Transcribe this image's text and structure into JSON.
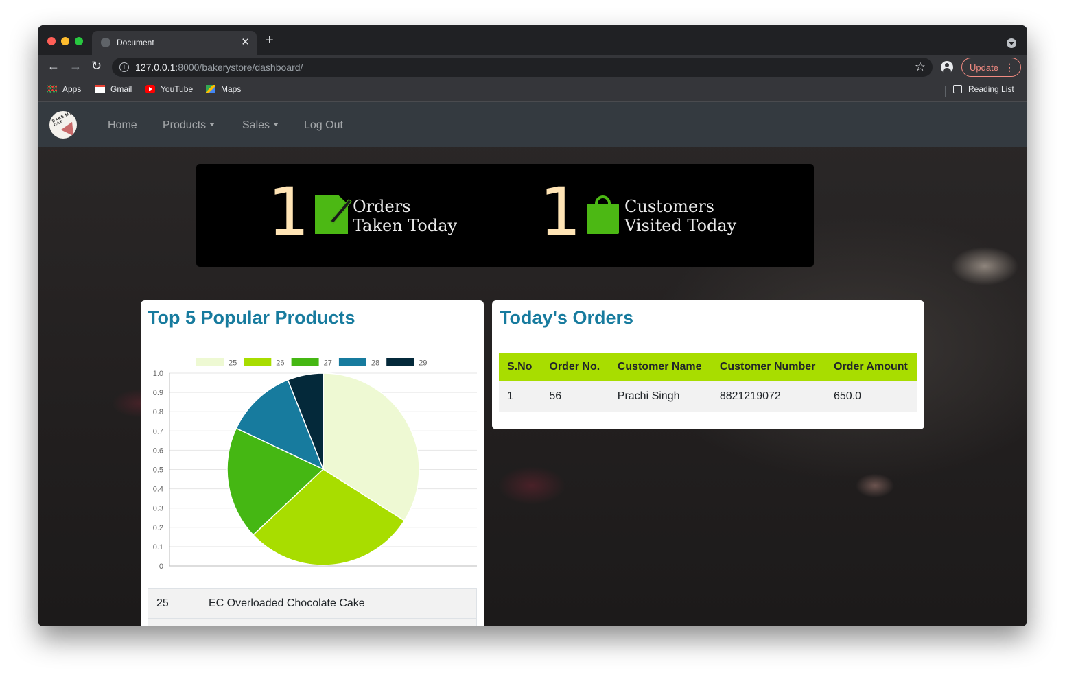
{
  "browser": {
    "tab_title": "Document",
    "url_host": "127.0.0.1",
    "url_rest": ":8000/bakerystore/dashboard/",
    "update_label": "Update",
    "bookmarks": {
      "apps": "Apps",
      "gmail": "Gmail",
      "youtube": "YouTube",
      "maps": "Maps",
      "reading_list": "Reading List"
    }
  },
  "nav": {
    "logo_text": "BAKE MY DAY",
    "home": "Home",
    "products": "Products",
    "sales": "Sales",
    "logout": "Log Out"
  },
  "stats": {
    "orders_count": "1",
    "orders_label": "Orders\nTaken Today",
    "customers_count": "1",
    "customers_label": "Customers\nVisited Today"
  },
  "popular": {
    "title": "Top 5 Popular Products",
    "rows": [
      {
        "id": "25",
        "name": "EC Overloaded Chocolate Cake"
      },
      {
        "id": "",
        "name": ""
      }
    ]
  },
  "chart_data": {
    "type": "pie",
    "categories": [
      "25",
      "26",
      "27",
      "28",
      "29"
    ],
    "values": [
      34,
      29,
      19,
      12,
      6
    ],
    "colors": [
      "#eef9d3",
      "#a8dd00",
      "#45b713",
      "#177b9e",
      "#04293a"
    ],
    "legend_position": "top",
    "y_ticks": [
      "0",
      "0.1",
      "0.2",
      "0.3",
      "0.4",
      "0.5",
      "0.6",
      "0.7",
      "0.8",
      "0.9",
      "1.0"
    ],
    "ylim": [
      0,
      1
    ],
    "grid": true
  },
  "orders": {
    "title": "Today's Orders",
    "headers": [
      "S.No",
      "Order No.",
      "Customer Name",
      "Customer Number",
      "Order Amount"
    ],
    "rows": [
      [
        "1",
        "56",
        "Prachi Singh",
        "8821219072",
        "650.0"
      ]
    ]
  },
  "colors": {
    "accent_green": "#a8dd00",
    "title_blue": "#177b9e",
    "stat_number": "#ffe4b5",
    "icon_green": "#4cb814"
  }
}
